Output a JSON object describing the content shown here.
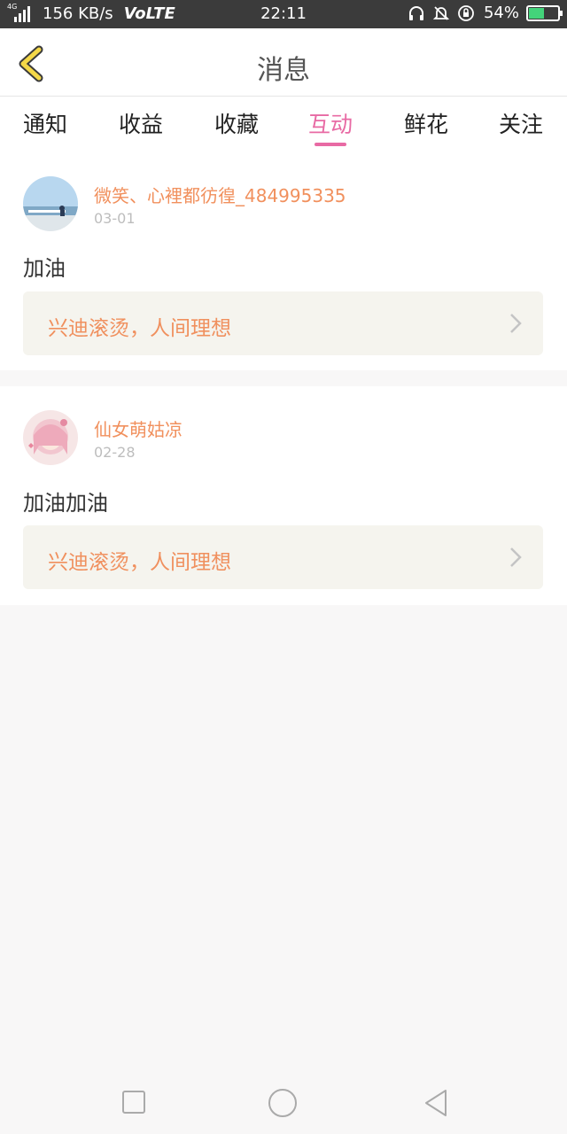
{
  "status_bar": {
    "network_tag": "4G",
    "speed": "156 KB/s",
    "volte": "VoLTE",
    "time": "22:11",
    "battery_percent": "54%",
    "battery_level": 0.54,
    "battery_color": "#43d37a"
  },
  "header": {
    "title": "消息"
  },
  "tabs": [
    {
      "label": "通知"
    },
    {
      "label": "收益"
    },
    {
      "label": "收藏"
    },
    {
      "label": "互动"
    },
    {
      "label": "鲜花"
    },
    {
      "label": "关注"
    }
  ],
  "active_tab": "互动",
  "accent_color": "#e86aa4",
  "name_color": "#f1905d",
  "messages": [
    {
      "username": "微笑、心裡都彷徨_484995335",
      "date": "03-01",
      "comment": "加油",
      "reference_title": "兴迪滚烫，人间理想"
    },
    {
      "username": "仙女萌姑凉",
      "date": "02-28",
      "comment": "加油加油",
      "reference_title": "兴迪滚烫，人间理想"
    }
  ],
  "nav": [
    "square-icon",
    "circle-icon",
    "triangle-back-icon"
  ]
}
